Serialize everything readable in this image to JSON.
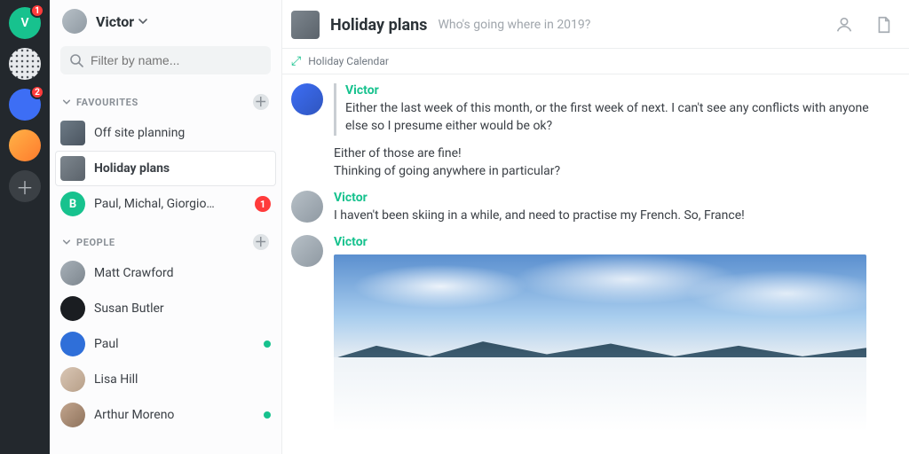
{
  "rail": {
    "items": [
      {
        "letter": "V",
        "bg": "#17c28e",
        "badge": "1"
      },
      {
        "letter": "",
        "bg": "#e8eaed",
        "badge": ""
      },
      {
        "letter": "",
        "bg": "#3d6ef5",
        "badge": "2"
      },
      {
        "letter": "",
        "bg": "#ff9f2d",
        "badge": ""
      }
    ]
  },
  "sidebar": {
    "user": "Victor",
    "search_placeholder": "Filter by name...",
    "sections": {
      "favourites": {
        "label": "FAVOURITES",
        "items": [
          {
            "label": "Off site planning",
            "badge": "",
            "kind": "room"
          },
          {
            "label": "Holiday plans",
            "badge": "",
            "kind": "room",
            "active": true
          },
          {
            "label": "Paul, Michal, Giorgio…",
            "badge": "1",
            "kind": "dm",
            "initial": "B",
            "bg": "#17c28e"
          }
        ]
      },
      "people": {
        "label": "PEOPLE",
        "items": [
          {
            "label": "Matt Crawford",
            "presence": false
          },
          {
            "label": "Susan Butler",
            "presence": false
          },
          {
            "label": "Paul",
            "presence": true
          },
          {
            "label": "Lisa Hill",
            "presence": false
          },
          {
            "label": "Arthur Moreno",
            "presence": true
          }
        ]
      }
    }
  },
  "header": {
    "title": "Holiday plans",
    "subtitle": "Who's going where in 2019?"
  },
  "widget": {
    "label": "Holiday Calendar"
  },
  "messages": [
    {
      "author": "Victor",
      "quote": "Either the last week of this month, or the first week of next. I can't see any conflicts with anyone else so I presume either would be ok?",
      "line1": "Either of those are fine!",
      "line2": "Thinking of going anywhere in particular?"
    },
    {
      "author": "Victor",
      "text": "I haven't been skiing in a while, and need to practise my French. So, France!"
    },
    {
      "author": "Victor",
      "image": true
    }
  ]
}
